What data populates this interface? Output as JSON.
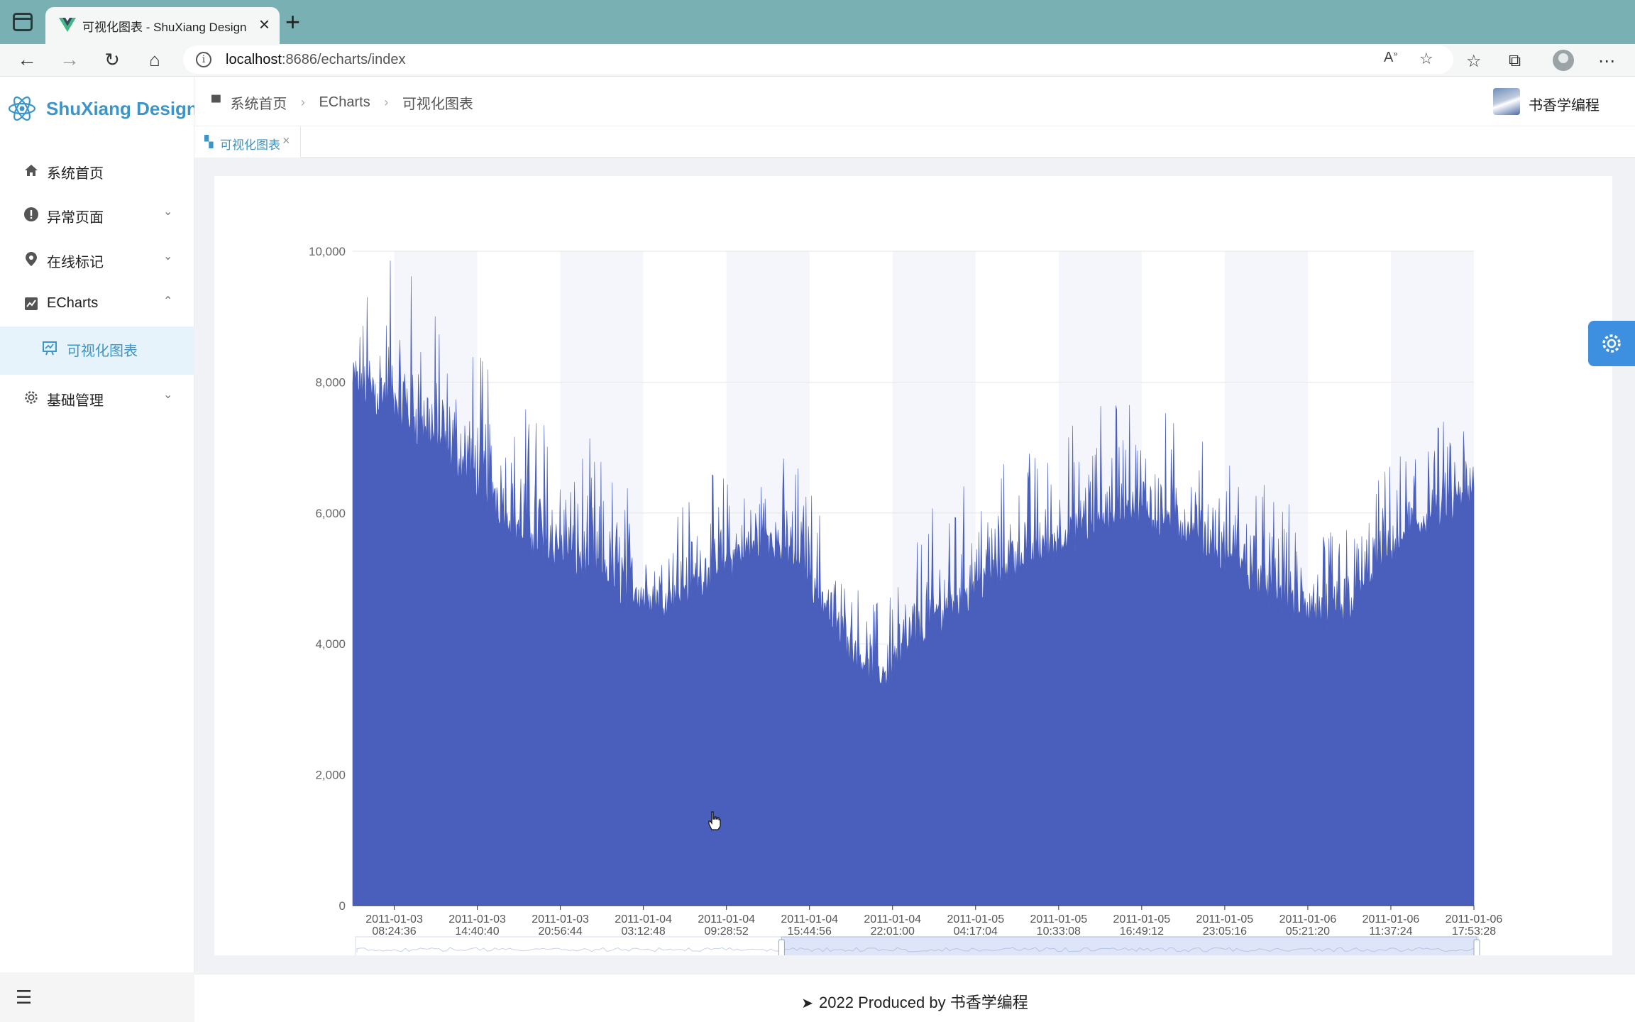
{
  "browser": {
    "tab_title": "可视化图表 - ShuXiang Design",
    "url_host": "localhost",
    "url_rest": ":8686/echarts/index"
  },
  "sidebar": {
    "logo_text": "ShuXiang Design",
    "items": [
      {
        "label": "系统首页",
        "icon": "home-icon",
        "arrow": ""
      },
      {
        "label": "异常页面",
        "icon": "alert-icon",
        "arrow": "⌄"
      },
      {
        "label": "在线标记",
        "icon": "location-pin-icon",
        "arrow": "⌄"
      },
      {
        "label": "ECharts",
        "icon": "chart-icon",
        "arrow": "⌃"
      },
      {
        "label": "可视化图表",
        "icon": "presentation-chart-icon",
        "arrow": ""
      },
      {
        "label": "基础管理",
        "icon": "gear-icon",
        "arrow": "⌄"
      }
    ]
  },
  "header": {
    "breadcrumb": [
      "系统首页",
      "ECharts",
      "可视化图表"
    ],
    "user_name": "书香学编程"
  },
  "page_tabs": [
    {
      "label": "可视化图表"
    }
  ],
  "footer": {
    "text": "2022 Produced by 书香学编程"
  },
  "theme": {
    "accent": "#3c95c8",
    "series_color": "#4a5fbc",
    "fab_color": "#3d8fe0"
  },
  "chart_data": {
    "type": "area",
    "title": "",
    "ylim": [
      0,
      10000
    ],
    "y_ticks": [
      "0",
      "2,000",
      "4,000",
      "6,000",
      "8,000",
      "10,000"
    ],
    "x_ticks": [
      [
        "2011-01-03",
        "08:24:36"
      ],
      [
        "2011-01-03",
        "14:40:40"
      ],
      [
        "2011-01-03",
        "20:56:44"
      ],
      [
        "2011-01-04",
        "03:12:48"
      ],
      [
        "2011-01-04",
        "09:28:52"
      ],
      [
        "2011-01-04",
        "15:44:56"
      ],
      [
        "2011-01-04",
        "22:01:00"
      ],
      [
        "2011-01-05",
        "04:17:04"
      ],
      [
        "2011-01-05",
        "10:33:08"
      ],
      [
        "2011-01-05",
        "16:49:12"
      ],
      [
        "2011-01-05",
        "23:05:16"
      ],
      [
        "2011-01-06",
        "05:21:20"
      ],
      [
        "2011-01-06",
        "11:37:24"
      ],
      [
        "2011-01-06",
        "17:53:28"
      ]
    ],
    "trend_anchors": [
      {
        "t": 0.0,
        "base": 7800,
        "peak": 9000
      },
      {
        "t": 0.04,
        "base": 7500,
        "peak": 9700
      },
      {
        "t": 0.1,
        "base": 6600,
        "peak": 8300
      },
      {
        "t": 0.15,
        "base": 5600,
        "peak": 7600
      },
      {
        "t": 0.22,
        "base": 5000,
        "peak": 6600
      },
      {
        "t": 0.27,
        "base": 4500,
        "peak": 5800
      },
      {
        "t": 0.31,
        "base": 4900,
        "peak": 6200
      },
      {
        "t": 0.37,
        "base": 5500,
        "peak": 6600
      },
      {
        "t": 0.4,
        "base": 5200,
        "peak": 6500
      },
      {
        "t": 0.43,
        "base": 4200,
        "peak": 5400
      },
      {
        "t": 0.45,
        "base": 3800,
        "peak": 4700
      },
      {
        "t": 0.47,
        "base": 3400,
        "peak": 4400
      },
      {
        "t": 0.52,
        "base": 4300,
        "peak": 5800
      },
      {
        "t": 0.57,
        "base": 5000,
        "peak": 6400
      },
      {
        "t": 0.62,
        "base": 5400,
        "peak": 6800
      },
      {
        "t": 0.69,
        "base": 6000,
        "peak": 7700
      },
      {
        "t": 0.75,
        "base": 5600,
        "peak": 6900
      },
      {
        "t": 0.8,
        "base": 5000,
        "peak": 6400
      },
      {
        "t": 0.85,
        "base": 4400,
        "peak": 5600
      },
      {
        "t": 0.88,
        "base": 4300,
        "peak": 5500
      },
      {
        "t": 0.92,
        "base": 5300,
        "peak": 6400
      },
      {
        "t": 0.96,
        "base": 5800,
        "peak": 7100
      },
      {
        "t": 1.0,
        "base": 6200,
        "peak": 7300
      }
    ],
    "data_zoom": {
      "start": 0.38,
      "end": 1.0
    }
  }
}
